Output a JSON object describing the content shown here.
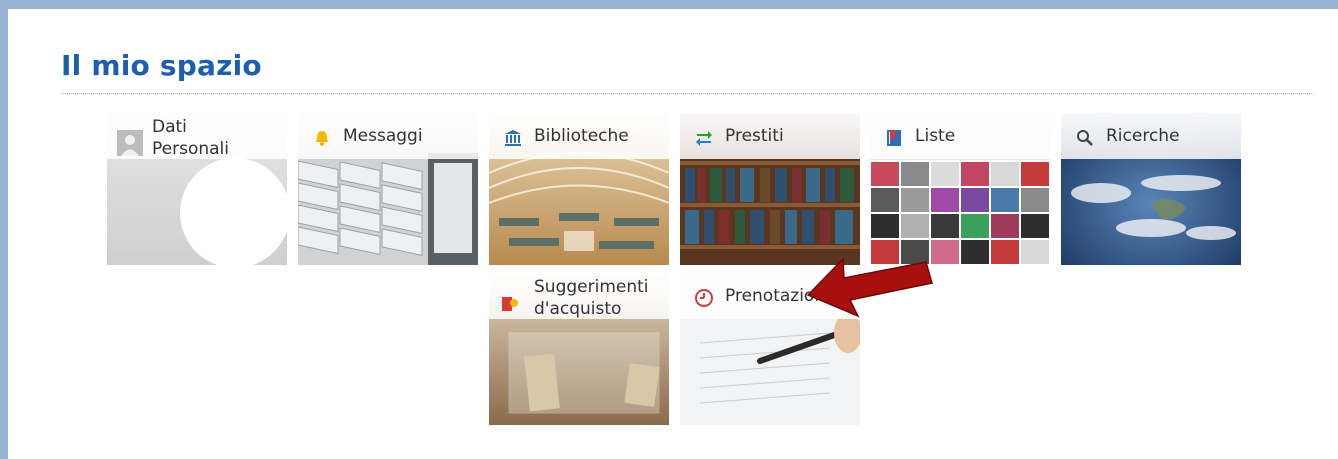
{
  "header": {
    "title": "Il mio spazio"
  },
  "tiles": [
    {
      "label_line1": "Dati",
      "label_line2": "Personali",
      "icon": "user-icon"
    },
    {
      "label": "Messaggi",
      "icon": "bell-icon"
    },
    {
      "label": "Biblioteche",
      "icon": "library-icon"
    },
    {
      "label": "Prestiti",
      "icon": "swap-arrows-icon"
    },
    {
      "label": "Liste",
      "icon": "list-book-icon"
    },
    {
      "label": "Ricerche",
      "icon": "search-icon"
    },
    {
      "label_line1": "Suggerimenti",
      "label_line2": "d'acquisto",
      "icon": "suggestion-icon"
    },
    {
      "label": "Prenotazioni",
      "icon": "clock-icon"
    }
  ],
  "colors": {
    "title": "#1d5fae",
    "frame": "#9ab3d3",
    "arrow": "#a80f0f"
  }
}
